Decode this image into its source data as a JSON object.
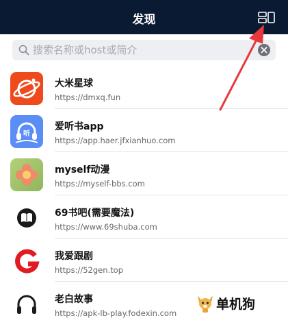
{
  "header": {
    "title": "发现"
  },
  "search": {
    "placeholder": "搜索名称或host或简介"
  },
  "sources": [
    {
      "name": "大米星球",
      "url": "https://dmxq.fun"
    },
    {
      "name": "爱听书app",
      "url": "https://app.haer.jfxianhuo.com"
    },
    {
      "name": "myself动漫",
      "url": "https://myself-bbs.com"
    },
    {
      "name": "69书吧(需要魔法)",
      "url": "https://www.69shuba.com"
    },
    {
      "name": "我爱跟剧",
      "url": "https://52gen.top"
    },
    {
      "name": "老白故事",
      "url": "https://apk-lb-play.fodexin.com"
    }
  ],
  "icons": {
    "source_0": "planet-logo-icon",
    "source_1": "headphones-listen-logo-icon",
    "source_2": "flower-logo-icon",
    "source_3": "book-logo-icon",
    "source_4": "letter-g-logo-icon",
    "source_5": "headphones-icon"
  },
  "watermark": {
    "text": "单机狗"
  },
  "colors": {
    "header_bg": "#0b1a33",
    "arrow": "#e8383d",
    "g_logo": "#e21b23"
  }
}
